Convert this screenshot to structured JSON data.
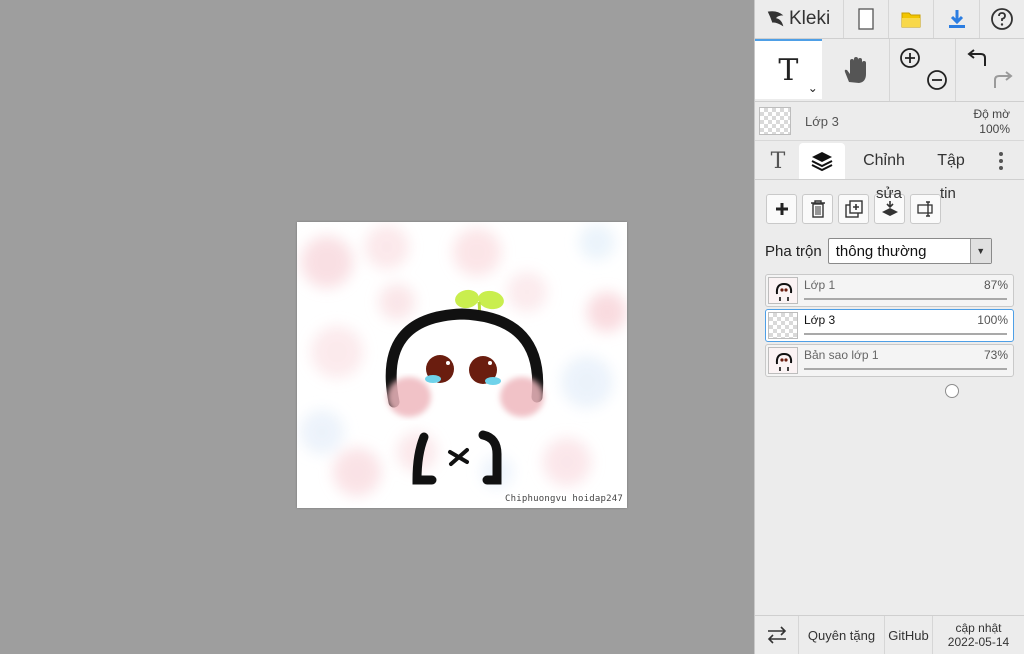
{
  "app": {
    "name": "Kleki"
  },
  "colors": {
    "accent": "#4e9fe6",
    "workspace": "#9e9e9e",
    "panel": "#ececec",
    "folder": "#f2c500",
    "download": "#2b7de1"
  },
  "topbar": {
    "icons": [
      "new-image-icon",
      "open-folder-icon",
      "download-icon",
      "help-icon"
    ]
  },
  "tools": {
    "active": {
      "label": "T",
      "icon": "text-tool-icon"
    },
    "hand": "hand-tool-icon",
    "zoom_in": "zoom-in-icon",
    "zoom_out": "zoom-out-icon",
    "undo": "undo-icon",
    "redo": "redo-icon"
  },
  "current_layer": {
    "name": "Lớp 3",
    "opacity_label": "Độ mờ",
    "opacity_value": "100%"
  },
  "tabs": {
    "text": "T",
    "layers_icon": "layers-icon",
    "edit": "Chỉnh",
    "edit_overflow": "sửa",
    "file": "Tập",
    "file_overflow": "tin",
    "more_icon": "more-vertical-icon"
  },
  "layer_actions": [
    "add-layer-icon",
    "delete-layer-icon",
    "duplicate-layer-icon",
    "merge-down-icon",
    "rename-layer-icon"
  ],
  "blend": {
    "label": "Pha trộn",
    "value": "thông thường"
  },
  "layers": [
    {
      "name": "Lớp 1",
      "opacity": "87%",
      "opacity_fraction": 0.87,
      "selected": false
    },
    {
      "name": "Lớp 3",
      "opacity": "100%",
      "opacity_fraction": 1.0,
      "selected": true
    },
    {
      "name": "Bản sao lớp 1",
      "opacity": "73%",
      "opacity_fraction": 0.73,
      "selected": false
    }
  ],
  "canvas": {
    "signature": "Chiphuongvu hoidap247"
  },
  "footer": {
    "swap_icon": "swap-arrows-icon",
    "donate": "Quyên tặng",
    "github": "GitHub",
    "update_label": "cập nhật",
    "update_date": "2022-05-14"
  }
}
